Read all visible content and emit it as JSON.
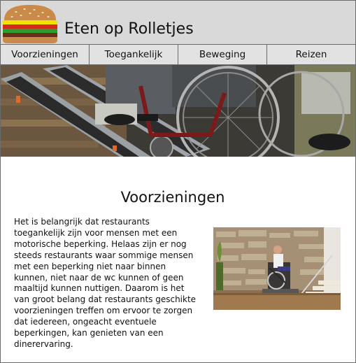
{
  "header": {
    "title": "Eten op Rolletjes",
    "logo_icon": "burger-icon"
  },
  "nav": {
    "items": [
      {
        "label": "Voorzieningen"
      },
      {
        "label": "Toegankelijk"
      },
      {
        "label": "Beweging"
      },
      {
        "label": "Reizen"
      }
    ]
  },
  "hero": {
    "image": "wheelchair-on-ramp-photo"
  },
  "main": {
    "heading": "Voorzieningen",
    "paragraph": "Het is belangrijk dat restaurants toegankelijk zijn voor mensen met een motorische beperking. Helaas zijn er nog steeds restaurants waar sommige mensen met een beperking niet naar binnen kunnen, niet naar de wc kunnen of geen maaltijd kunnen nuttigen. Daarom is het van groot belang dat restaurants geschikte voorzieningen treffen om ervoor te zorgen dat iedereen, ongeacht eventuele beperkingen, kan genieten van een dinerervaring.",
    "photo": "wheelchair-platform-lift-photo"
  },
  "colors": {
    "header_bg": "#d9d9d9",
    "nav_bg": "#e2e2e2",
    "border": "#6b6b6b"
  }
}
